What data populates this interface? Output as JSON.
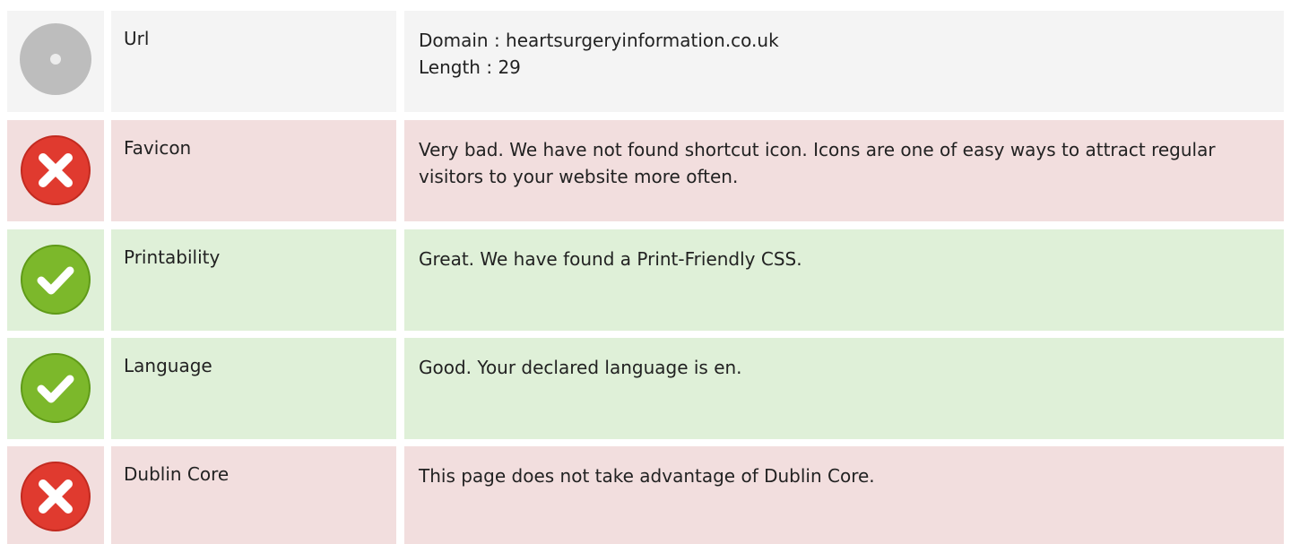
{
  "rows": [
    {
      "status": "neutral",
      "icon": "neutral-disc-icon",
      "label": "Url",
      "lines": [
        "Domain : heartsurgeryinformation.co.uk",
        "Length : 29"
      ]
    },
    {
      "status": "bad",
      "icon": "error-cross-icon",
      "label": "Favicon",
      "lines": [
        "Very bad. We have not found shortcut icon. Icons are one of easy ways to attract regular visitors to your website more often."
      ]
    },
    {
      "status": "good",
      "icon": "success-check-icon",
      "label": "Printability",
      "lines": [
        "Great. We have found a Print-Friendly CSS."
      ]
    },
    {
      "status": "good",
      "icon": "success-check-icon",
      "label": "Language",
      "lines": [
        "Good. Your declared language is en."
      ]
    },
    {
      "status": "bad",
      "icon": "error-cross-icon",
      "label": "Dublin Core",
      "lines": [
        "This page does not take advantage of Dublin Core."
      ]
    }
  ],
  "colors": {
    "neutral_bg": "#f4f4f4",
    "bad_bg": "#f2dede",
    "good_bg": "#dff0d8",
    "error_red": "#e03a2f",
    "success_green": "#7cb82b",
    "neutral_grey": "#bdbdbd"
  }
}
